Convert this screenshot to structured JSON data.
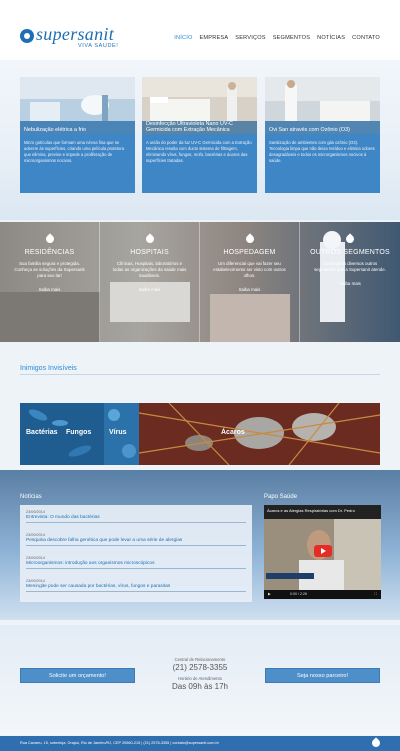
{
  "brand": {
    "name": "supersanit",
    "tagline": "VIVA SAUDE!"
  },
  "nav": [
    "INÍCIO",
    "EMPRESA",
    "SERVIÇOS",
    "SEGMENTOS",
    "NOTÍCIAS",
    "CONTATO"
  ],
  "cards": [
    {
      "title": "Nebulização elétrica a frio",
      "text": "Micro gotículas que formam uma névoa fina que se aderem às superfícies, criando uma película protetora que elimina, previne e impede a proliferação de microorganismos nocivos."
    },
    {
      "title": "Desinfecção Ultravioleta Nano UV-C Germicida com Extração Mecânica",
      "text": "A união do poder da luz UV-C Germicida com a Extração Mecânica resulta com ducto sistema de filtragem, eliminando vírus, fungos, mofo, bactérias e ácaros das superfícies tratadas."
    },
    {
      "title": "Ovi San através com Ozônio (O3)",
      "text": "Sanitização de ambientes com gás ozônio (O3). Tecnologia limpa que não deixa resíduo e elimina odores desagradáveis e todos os microrganismos nocivos à saúde."
    }
  ],
  "segments": [
    {
      "title": "RESIDÊNCIAS",
      "text": "Sua familia segura e protegida. Conheça as soluções da Supersanit para seu lar!",
      "more": "Saiba mais"
    },
    {
      "title": "HOSPITAIS",
      "text": "Clínicas, Hospitais, laboratórios e todas as organizações da saúde mais saudáveis.",
      "more": "Saiba mais"
    },
    {
      "title": "HOSPEDAGEM",
      "text": "Um diferencial que vai fazer seu estabelecimento ser visto com outros olhos.",
      "more": "Saiba mais"
    },
    {
      "title": "OUTROS SEGMENTOS",
      "text": "Conheça os diversos outros segmentos que a Supersanit atende.",
      "more": "Saiba mais"
    }
  ],
  "inimigos": {
    "title": "Inimigos Invisíveis",
    "items": [
      "Bactérias",
      "Fungos",
      "Vírus",
      "Ácaros"
    ]
  },
  "noticias": {
    "title": "Notícias",
    "items": [
      {
        "date": "23/09/2014",
        "title": "Entrevista: O mundo das bactérias"
      },
      {
        "date": "23/09/2014",
        "title": "Pesquisa descobre falha genética que pode levar a uma série de alergias"
      },
      {
        "date": "23/09/2014",
        "title": "Microorganismos: introdução aos organismos microscópicos"
      },
      {
        "date": "23/09/2014",
        "title": "Meningite pode ser causada por bactérias, vírus, fungos e parasitas"
      }
    ]
  },
  "papo": {
    "title": "Papo Saúde",
    "video_title": "Ácaros e as Alergias Respiratórias com Dr. Pedro",
    "time": "0:00 / 2:26"
  },
  "contact": {
    "cta_left": "Solicite um orçamento!",
    "cta_right": "Seja nosso parceiro!",
    "central_label": "Central de Relacionamento",
    "phone": "(21) 2578-3355",
    "hours_label": "Horário de Atendimento",
    "hours": "Das 09h às 17h"
  },
  "footer": {
    "text": "Rua Cavarru, 15, sobreloja, Grajaú, Rio de Janeiro/RJ, CEP 20560-215  |  (21) 2578-3355  |  contato@supersanit.com.br"
  },
  "colors": {
    "primary": "#1f6fb2",
    "accent": "#2a8bd3",
    "card": "#3f86c7",
    "footer": "#2f6fb0"
  }
}
